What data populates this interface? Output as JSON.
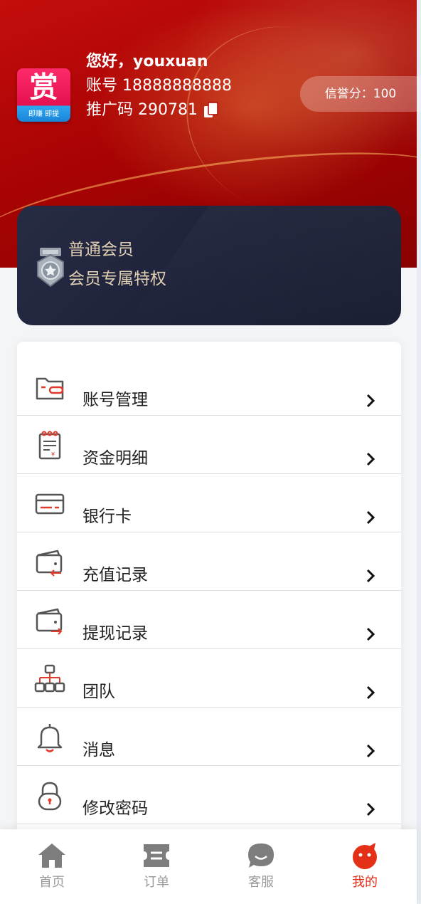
{
  "header": {
    "logo": {
      "glyph": "赏",
      "subtitle": "即赚 即提"
    },
    "greeting": "您好，youxuan",
    "account": "账号 18888888888",
    "promo_code": "推广码 290781",
    "credit_score": "信誉分：100"
  },
  "member": {
    "level": "普通会员",
    "privilege": "会员专属特权"
  },
  "menu": {
    "items": [
      {
        "label": "账号管理",
        "icon": "account-card-icon"
      },
      {
        "label": "资金明细",
        "icon": "fund-detail-icon"
      },
      {
        "label": "银行卡",
        "icon": "bank-card-icon"
      },
      {
        "label": "充值记录",
        "icon": "recharge-wallet-icon"
      },
      {
        "label": "提现记录",
        "icon": "withdraw-wallet-icon"
      },
      {
        "label": "团队",
        "icon": "team-icon"
      },
      {
        "label": "消息",
        "icon": "bell-icon"
      },
      {
        "label": "修改密码",
        "icon": "lock-icon"
      }
    ]
  },
  "tabbar": {
    "tabs": [
      {
        "label": "首页",
        "icon": "home-icon"
      },
      {
        "label": "订单",
        "icon": "ticket-icon"
      },
      {
        "label": "客服",
        "icon": "chat-icon"
      },
      {
        "label": "我的",
        "icon": "profile-icon"
      }
    ],
    "active_index": 3
  },
  "colors": {
    "header_red": "#b00606",
    "accent": "#e53018",
    "card_dark": "#1d2138",
    "gold_text": "#e0cfb3",
    "inactive_tab": "#9a9a9a"
  }
}
